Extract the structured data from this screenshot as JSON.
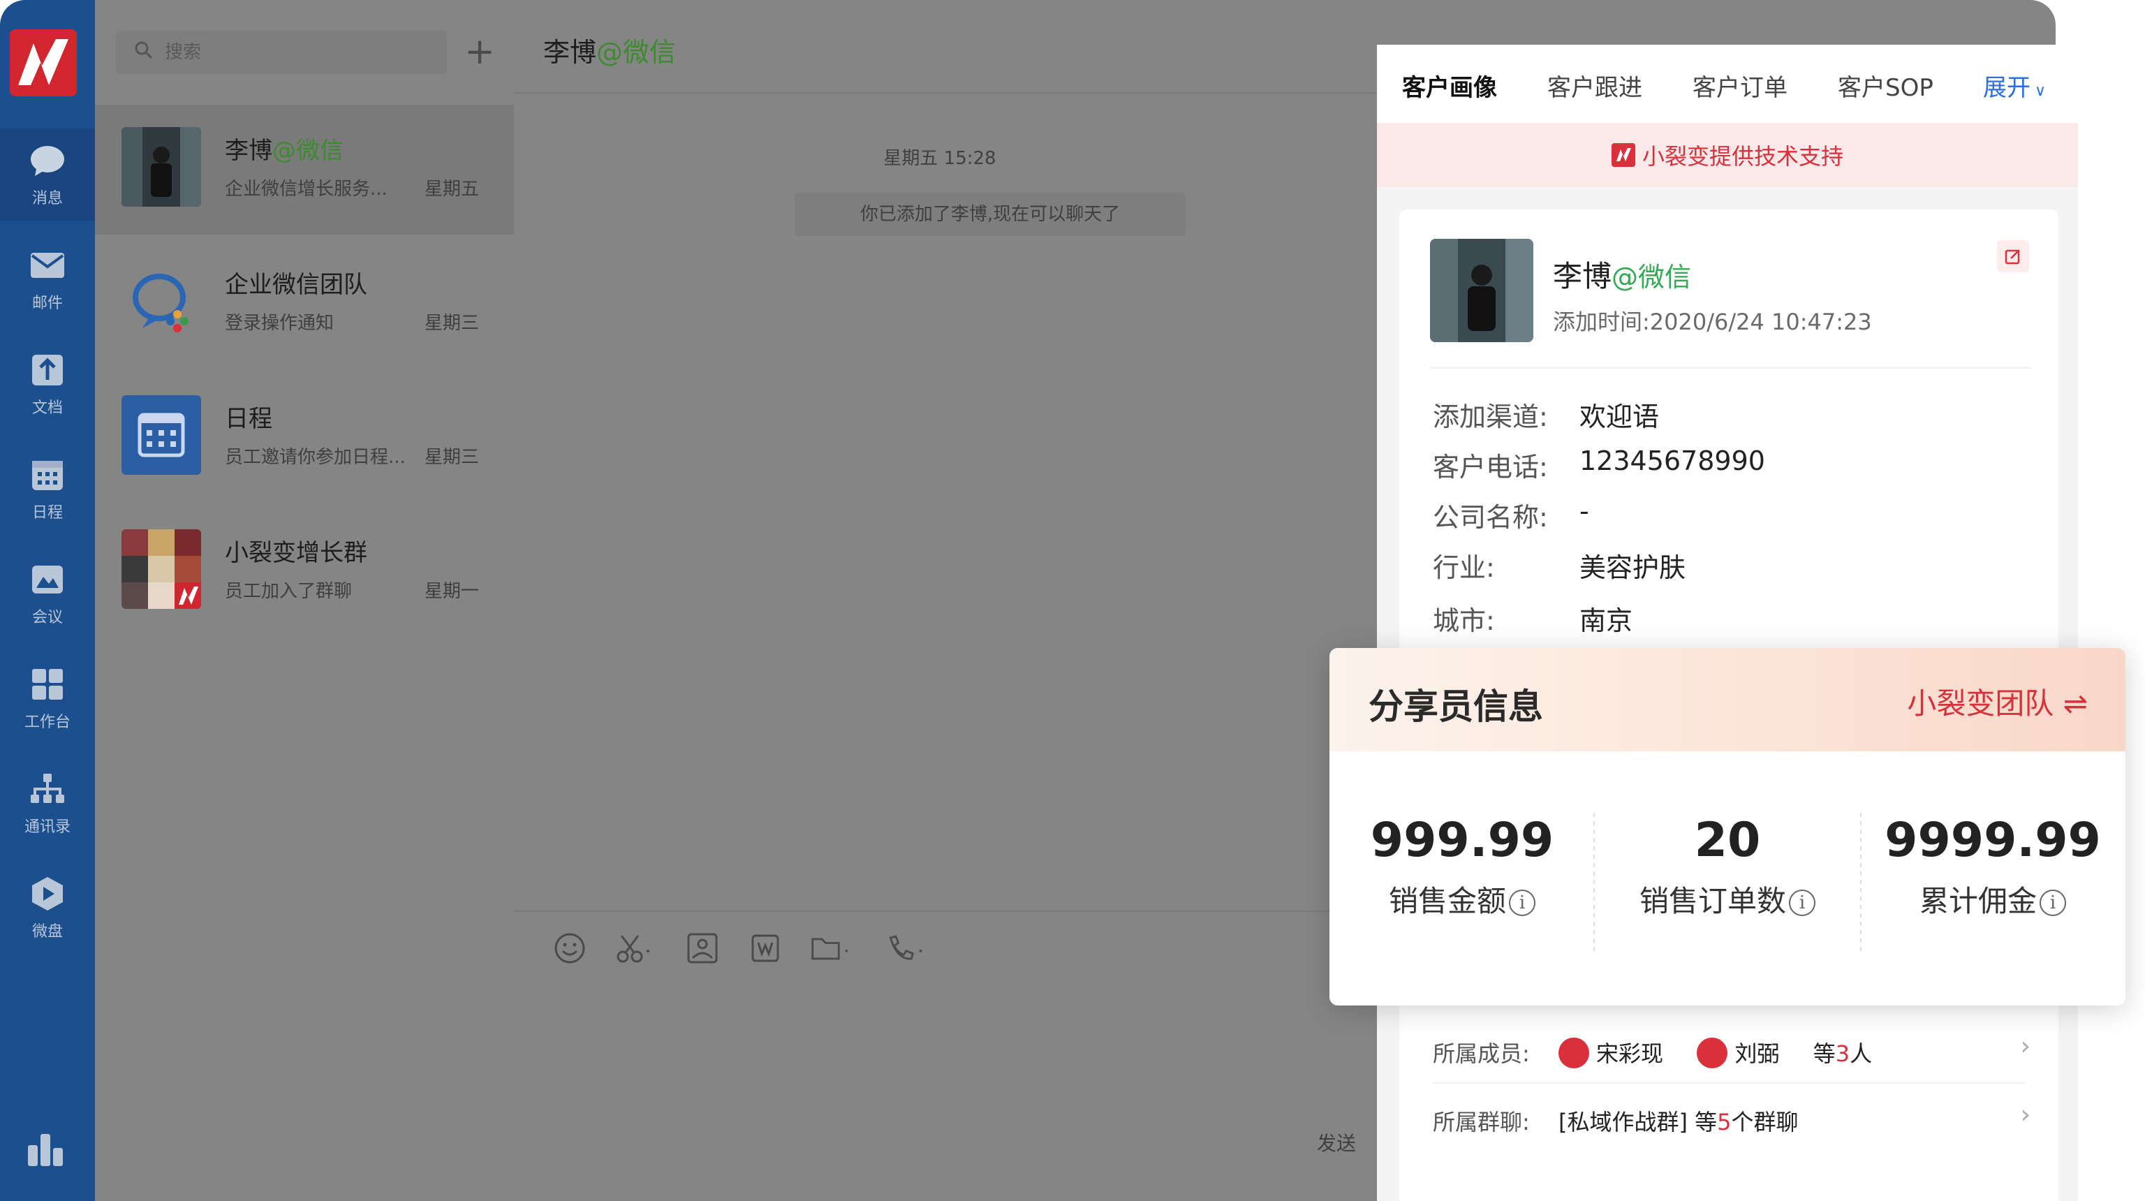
{
  "sidebar": {
    "items": [
      {
        "label": "消息",
        "icon": "message-icon"
      },
      {
        "label": "邮件",
        "icon": "mail-icon"
      },
      {
        "label": "文档",
        "icon": "document-icon"
      },
      {
        "label": "日程",
        "icon": "calendar-icon"
      },
      {
        "label": "会议",
        "icon": "meeting-icon"
      },
      {
        "label": "工作台",
        "icon": "workbench-icon"
      },
      {
        "label": "通讯录",
        "icon": "contacts-icon"
      },
      {
        "label": "微盘",
        "icon": "drive-icon"
      }
    ]
  },
  "search": {
    "placeholder": "搜索"
  },
  "conversations": [
    {
      "name": "李博",
      "suffix": "@微信",
      "preview": "企业微信增长服务...",
      "time": "星期五"
    },
    {
      "name": "企业微信团队",
      "suffix": "",
      "preview": "登录操作通知",
      "time": "星期三"
    },
    {
      "name": "日程",
      "suffix": "",
      "preview": "员工邀请你参加日程...",
      "time": "星期三"
    },
    {
      "name": "小裂变增长群",
      "suffix": "",
      "preview": "员工加入了群聊",
      "time": "星期一"
    }
  ],
  "chat": {
    "title_name": "李博",
    "title_suffix": "@微信",
    "timestamp": "星期五 15:28",
    "system_message": "你已添加了李博,现在可以聊天了",
    "send_label": "发送"
  },
  "panel": {
    "tabs": [
      "客户画像",
      "客户跟进",
      "客户订单",
      "客户SOP"
    ],
    "expand_label": "展开",
    "support_text": "小裂变提供技术支持",
    "profile": {
      "name": "李博",
      "suffix": "@微信",
      "added_label": "添加时间:",
      "added_time": "2020/6/24 10:47:23"
    },
    "fields": [
      {
        "label": "添加渠道:",
        "value": "欢迎语"
      },
      {
        "label": "客户电话:",
        "value": "12345678990"
      },
      {
        "label": "公司名称:",
        "value": "-"
      },
      {
        "label": "行业:",
        "value": "美容护肤"
      },
      {
        "label": "城市:",
        "value": "南京"
      }
    ],
    "share": {
      "title": "分享员信息",
      "team": "小裂变团队",
      "switch_icon": "⇌",
      "stats": [
        {
          "value": "999.99",
          "label": "销售金额"
        },
        {
          "value": "20",
          "label": "销售订单数"
        },
        {
          "value": "9999.99",
          "label": "累计佣金"
        }
      ]
    },
    "members": {
      "label": "所属成员:",
      "names": [
        "宋彩现",
        "刘弼"
      ],
      "prefix": "等",
      "count": "3",
      "suffix": "人"
    },
    "groups": {
      "label": "所属群聊:",
      "name": "[私域作战群]",
      "prefix": "等",
      "count": "5",
      "suffix": "个群聊"
    }
  },
  "colors": {
    "rail": "#1c4f8e",
    "accent_red": "#d9303b",
    "wechat_green": "#34a853",
    "link_blue": "#2b6fe0"
  }
}
